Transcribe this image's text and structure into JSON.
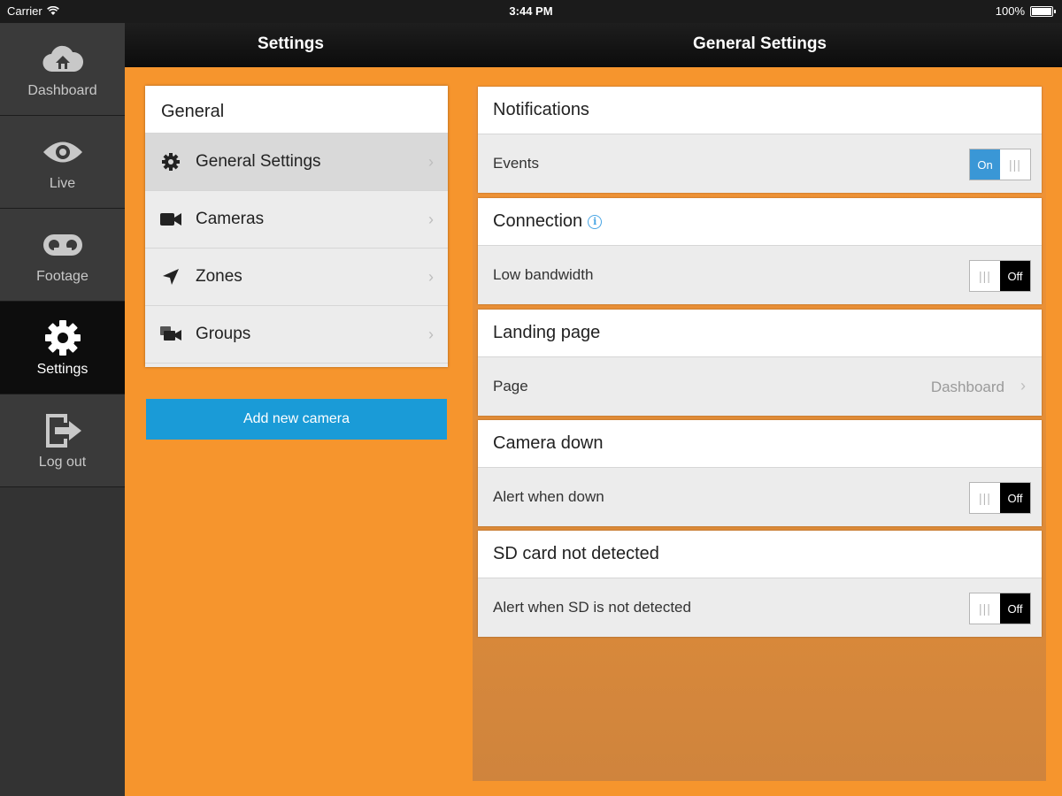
{
  "status_bar": {
    "carrier": "Carrier",
    "time": "3:44 PM",
    "battery": "100%"
  },
  "nav": {
    "items": [
      {
        "label": "Dashboard",
        "icon": "cloud-home-icon"
      },
      {
        "label": "Live",
        "icon": "eye-icon"
      },
      {
        "label": "Footage",
        "icon": "tape-reel-icon"
      },
      {
        "label": "Settings",
        "icon": "gear-icon",
        "active": true
      },
      {
        "label": "Log out",
        "icon": "logout-icon"
      }
    ]
  },
  "header": {
    "left_title": "Settings",
    "right_title": "General Settings"
  },
  "menu": {
    "header": "General",
    "items": [
      {
        "label": "General Settings",
        "icon": "gear-icon",
        "selected": true
      },
      {
        "label": "Cameras",
        "icon": "video-camera-icon"
      },
      {
        "label": "Zones",
        "icon": "location-arrow-icon"
      },
      {
        "label": "Groups",
        "icon": "camera-group-icon"
      }
    ],
    "add_button": "Add new camera"
  },
  "sections": {
    "notifications": {
      "title": "Notifications",
      "row_label": "Events",
      "toggle_on": true,
      "toggle_text": "On"
    },
    "connection": {
      "title": "Connection",
      "row_label": "Low bandwidth",
      "toggle_on": false,
      "toggle_text": "Off"
    },
    "landing": {
      "title": "Landing page",
      "row_label": "Page",
      "value": "Dashboard"
    },
    "camera_down": {
      "title": "Camera down",
      "row_label": "Alert when down",
      "toggle_on": false,
      "toggle_text": "Off"
    },
    "sd_card": {
      "title": "SD card not detected",
      "row_label": "Alert when SD is not detected",
      "toggle_on": false,
      "toggle_text": "Off"
    }
  },
  "colors": {
    "accent_orange": "#f6952d",
    "toggle_blue": "#3a97d6",
    "button_blue": "#1a9bd7"
  }
}
